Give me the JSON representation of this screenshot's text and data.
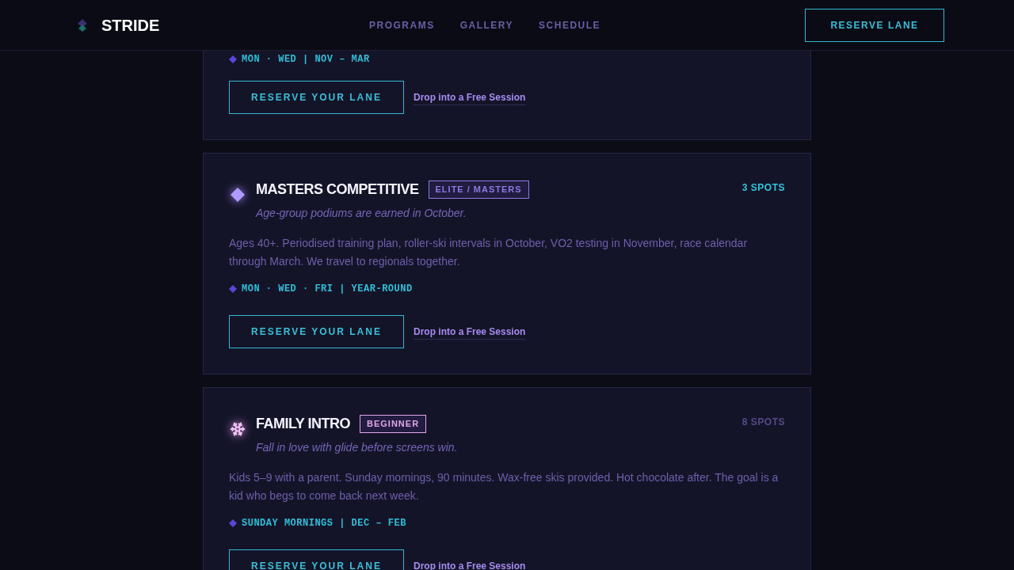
{
  "header": {
    "brand": "STRIDE",
    "nav": [
      "PROGRAMS",
      "GALLERY",
      "SCHEDULE"
    ],
    "cta": "RESERVE LANE"
  },
  "programs": [
    {
      "schedule": "MON · WED | NOV – MAR",
      "primary": "RESERVE YOUR LANE",
      "secondary": "Drop into a Free Session"
    },
    {
      "kind": "diamond",
      "title": "MASTERS COMPETITIVE",
      "badge": {
        "text": "ELITE / MASTERS",
        "color": "#8b7ae0"
      },
      "spots": {
        "text": "3 SPOTS",
        "highlighted": true
      },
      "tagline": "Age-group podiums are earned in October.",
      "description": "Ages 40+. Periodised training plan, roller-ski intervals in October, VO2 testing in November, race calendar through March. We travel to regionals together.",
      "schedule": "MON · WED · FRI | YEAR-ROUND",
      "primary": "RESERVE YOUR LANE",
      "secondary": "Drop into a Free Session"
    },
    {
      "kind": "snowflake",
      "title": "FAMILY INTRO",
      "badge": {
        "text": "BEGINNER",
        "color": "#e3a6e8"
      },
      "spots": {
        "text": "8 SPOTS",
        "highlighted": false
      },
      "tagline": "Fall in love with glide before screens win.",
      "description": "Kids 5–9 with a parent. Sunday mornings, 90 minutes. Wax-free skis provided. Hot chocolate after. The goal is a kid who begs to come back next week.",
      "schedule": "SUNDAY MORNINGS | DEC – FEB",
      "primary": "RESERVE YOUR LANE",
      "secondary": "Drop into a Free Session"
    }
  ]
}
